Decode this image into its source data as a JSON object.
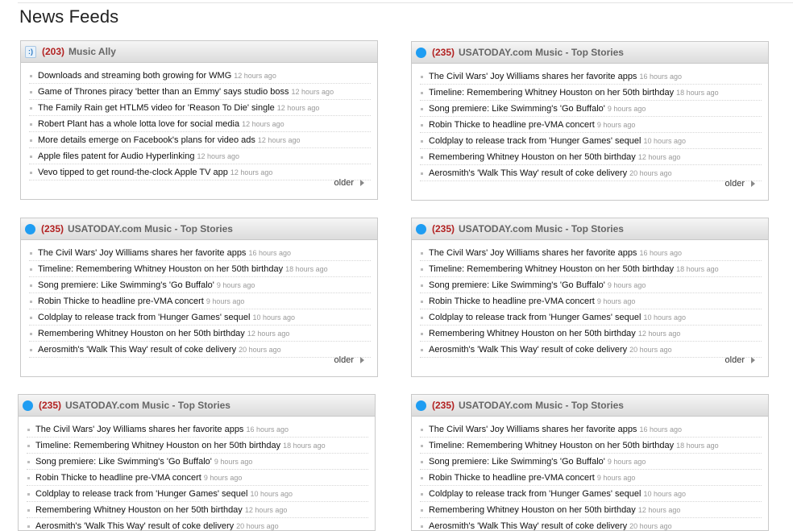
{
  "page": {
    "title": "News Feeds"
  },
  "more_label": "older",
  "colors": {
    "count": "#b22222",
    "icon": "#1f9df2"
  },
  "feeds": [
    {
      "icon": "music-ally-icon",
      "count": "(203)",
      "source": "Music Ally",
      "items": [
        {
          "title": "Downloads and streaming both growing for WMG",
          "age": "12 hours ago"
        },
        {
          "title": "Game of Thrones piracy 'better than an Emmy' says studio boss",
          "age": "12 hours ago"
        },
        {
          "title": "The Family Rain get HTLM5 video for 'Reason To Die' single",
          "age": "12 hours ago"
        },
        {
          "title": "Robert Plant has a whole lotta love for social media",
          "age": "12 hours ago"
        },
        {
          "title": "More details emerge on Facebook's plans for video ads",
          "age": "12 hours ago"
        },
        {
          "title": "Apple files patent for Audio Hyperlinking",
          "age": "12 hours ago"
        },
        {
          "title": "Vevo tipped to get round-the-clock Apple TV app",
          "age": "12 hours ago"
        }
      ]
    },
    {
      "icon": "usatoday-icon",
      "count": "(235)",
      "source": "USATODAY.com Music - Top Stories",
      "items": [
        {
          "title": "The Civil Wars' Joy Williams shares her favorite apps",
          "age": "16 hours ago"
        },
        {
          "title": "Timeline: Remembering Whitney Houston on her 50th birthday",
          "age": "18 hours ago"
        },
        {
          "title": "Song premiere: Like Swimming's 'Go Buffalo'",
          "age": "9 hours ago"
        },
        {
          "title": "Robin Thicke to headline pre-VMA concert",
          "age": "9 hours ago"
        },
        {
          "title": "Coldplay to release track from 'Hunger Games' sequel",
          "age": "10 hours ago"
        },
        {
          "title": "Remembering Whitney Houston on her 50th birthday",
          "age": "12 hours ago"
        },
        {
          "title": "Aerosmith's 'Walk This Way' result of coke delivery",
          "age": "20 hours ago"
        }
      ]
    },
    {
      "icon": "usatoday-icon",
      "count": "(235)",
      "source": "USATODAY.com Music - Top Stories",
      "items": [
        {
          "title": "The Civil Wars' Joy Williams shares her favorite apps",
          "age": "16 hours ago"
        },
        {
          "title": "Timeline: Remembering Whitney Houston on her 50th birthday",
          "age": "18 hours ago"
        },
        {
          "title": "Song premiere: Like Swimming's 'Go Buffalo'",
          "age": "9 hours ago"
        },
        {
          "title": "Robin Thicke to headline pre-VMA concert",
          "age": "9 hours ago"
        },
        {
          "title": "Coldplay to release track from 'Hunger Games' sequel",
          "age": "10 hours ago"
        },
        {
          "title": "Remembering Whitney Houston on her 50th birthday",
          "age": "12 hours ago"
        },
        {
          "title": "Aerosmith's 'Walk This Way' result of coke delivery",
          "age": "20 hours ago"
        }
      ]
    },
    {
      "icon": "usatoday-icon",
      "count": "(235)",
      "source": "USATODAY.com Music - Top Stories",
      "items": [
        {
          "title": "The Civil Wars' Joy Williams shares her favorite apps",
          "age": "16 hours ago"
        },
        {
          "title": "Timeline: Remembering Whitney Houston on her 50th birthday",
          "age": "18 hours ago"
        },
        {
          "title": "Song premiere: Like Swimming's 'Go Buffalo'",
          "age": "9 hours ago"
        },
        {
          "title": "Robin Thicke to headline pre-VMA concert",
          "age": "9 hours ago"
        },
        {
          "title": "Coldplay to release track from 'Hunger Games' sequel",
          "age": "10 hours ago"
        },
        {
          "title": "Remembering Whitney Houston on her 50th birthday",
          "age": "12 hours ago"
        },
        {
          "title": "Aerosmith's 'Walk This Way' result of coke delivery",
          "age": "20 hours ago"
        }
      ]
    },
    {
      "icon": "usatoday-icon",
      "count": "(235)",
      "source": "USATODAY.com Music - Top Stories",
      "items": [
        {
          "title": "The Civil Wars' Joy Williams shares her favorite apps",
          "age": "16 hours ago"
        },
        {
          "title": "Timeline: Remembering Whitney Houston on her 50th birthday",
          "age": "18 hours ago"
        },
        {
          "title": "Song premiere: Like Swimming's 'Go Buffalo'",
          "age": "9 hours ago"
        },
        {
          "title": "Robin Thicke to headline pre-VMA concert",
          "age": "9 hours ago"
        },
        {
          "title": "Coldplay to release track from 'Hunger Games' sequel",
          "age": "10 hours ago"
        },
        {
          "title": "Remembering Whitney Houston on her 50th birthday",
          "age": "12 hours ago"
        },
        {
          "title": "Aerosmith's 'Walk This Way' result of coke delivery",
          "age": "20 hours ago"
        }
      ]
    },
    {
      "icon": "usatoday-icon",
      "count": "(235)",
      "source": "USATODAY.com Music - Top Stories",
      "items": [
        {
          "title": "The Civil Wars' Joy Williams shares her favorite apps",
          "age": "16 hours ago"
        },
        {
          "title": "Timeline: Remembering Whitney Houston on her 50th birthday",
          "age": "18 hours ago"
        },
        {
          "title": "Song premiere: Like Swimming's 'Go Buffalo'",
          "age": "9 hours ago"
        },
        {
          "title": "Robin Thicke to headline pre-VMA concert",
          "age": "9 hours ago"
        },
        {
          "title": "Coldplay to release track from 'Hunger Games' sequel",
          "age": "10 hours ago"
        },
        {
          "title": "Remembering Whitney Houston on her 50th birthday",
          "age": "12 hours ago"
        },
        {
          "title": "Aerosmith's 'Walk This Way' result of coke delivery",
          "age": "20 hours ago"
        }
      ]
    }
  ]
}
